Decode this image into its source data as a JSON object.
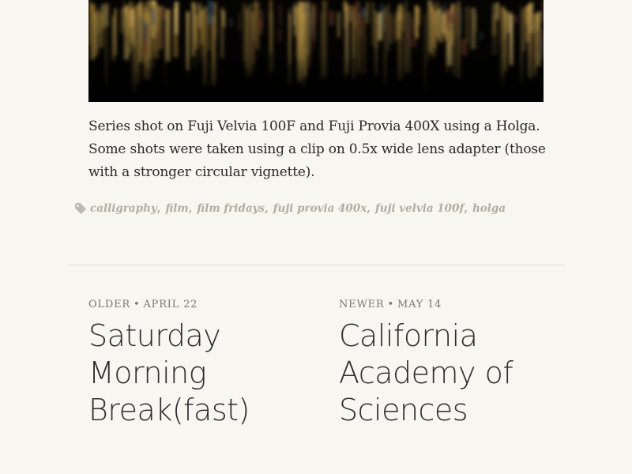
{
  "post": {
    "caption": "Series shot on Fuji Velvia 100F and Fuji Provia 400X using a Holga. Some shots were taken using a clip on 0.5x wide lens adapter (those with a stronger circular vignette).",
    "tags": [
      "calligraphy",
      "film",
      "film fridays",
      "fuji provia 400x",
      "fuji velvia 100f",
      "holga"
    ]
  },
  "navigation": {
    "older": {
      "label": "OLDER",
      "date": "APRIL 22",
      "title": "Saturday Morning Break(fast)"
    },
    "newer": {
      "label": "NEWER",
      "date": "MAY 14",
      "title": "California Academy of Sciences"
    }
  },
  "colors": {
    "background": "#f8f6f1",
    "tag": "#b3aca0",
    "meta": "#7a766f",
    "text": "#2b2b2b"
  },
  "icons": {
    "tag": "tag-icon"
  }
}
